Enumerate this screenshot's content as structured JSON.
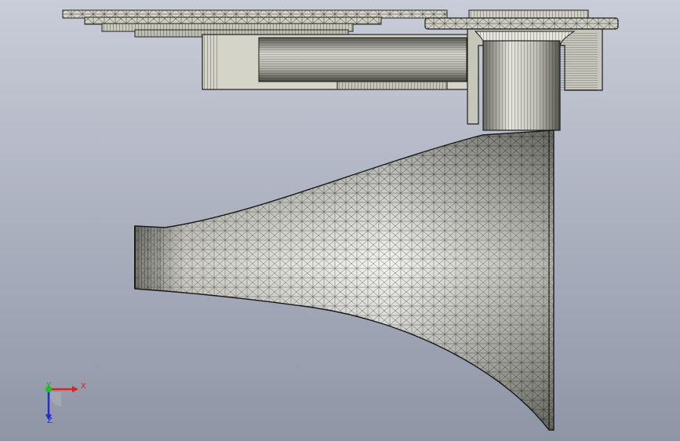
{
  "viewport": {
    "background_top": "#c8ccd8",
    "background_bottom": "#8f96a6"
  },
  "model": {
    "mesh_color": "#2a2a2a",
    "face_color": "#d8d8cc",
    "highlight_color": "#ffffff",
    "parts": [
      "mounting-plate",
      "driver-housing",
      "throat-tube",
      "horn-flare"
    ]
  },
  "triad": {
    "x_label": "X",
    "y_label": "Y",
    "z_label": "Z",
    "x_color": "#e02020",
    "y_color": "#20c020",
    "z_color": "#2030d0"
  }
}
